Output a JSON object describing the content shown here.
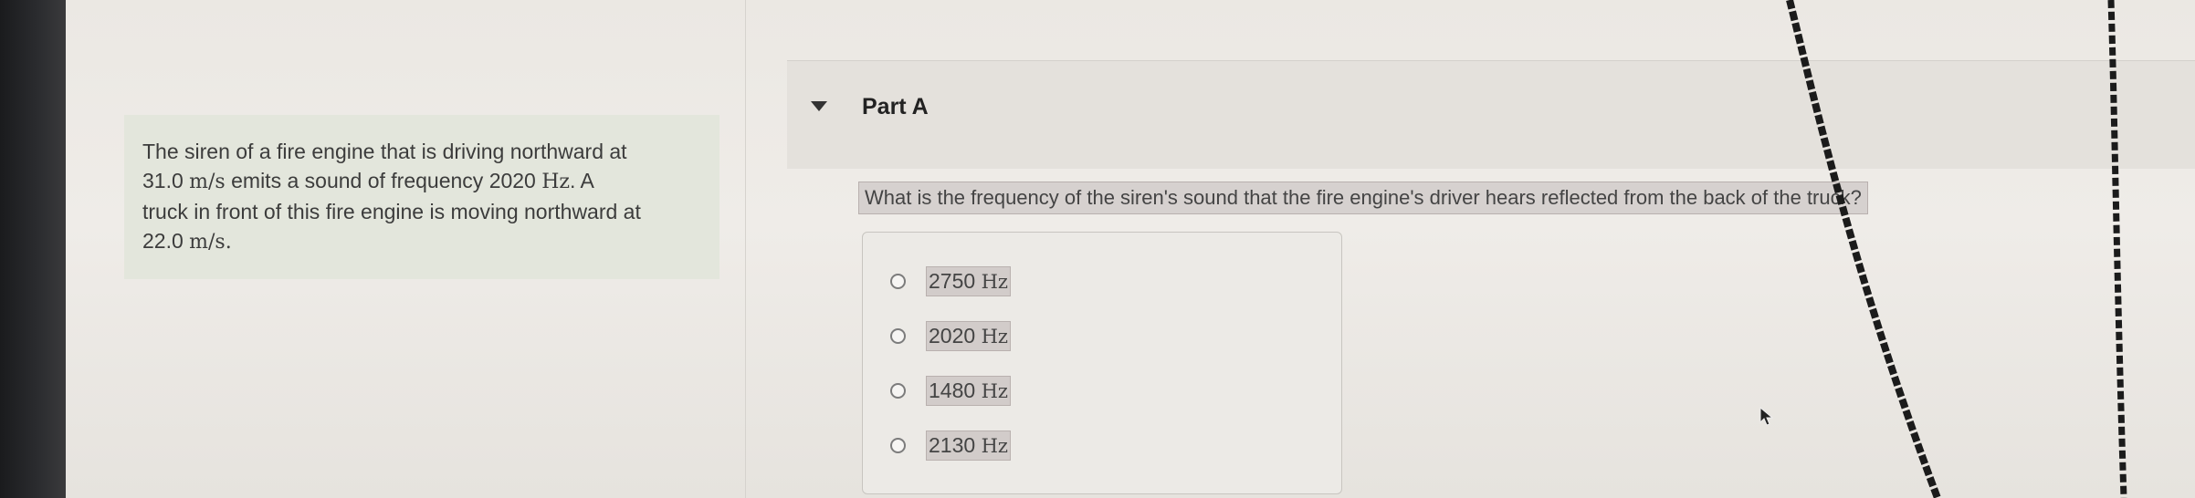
{
  "problem": {
    "line1": "The siren of a fire engine that is driving northward at",
    "line2_value": "31.0",
    "line2_unit": "m/s",
    "line2_mid": "emits a sound of frequency",
    "line2_freq": "2020",
    "line2_freq_unit": "Hz",
    "line2_end": ". A",
    "line3": "truck in front of this fire engine is moving northward at",
    "line4_value": "22.0",
    "line4_unit": "m/s",
    "line4_end": "."
  },
  "part": {
    "title": "Part A",
    "question": "What is the frequency of the siren's sound that the fire engine's driver hears reflected from the back of the truck?"
  },
  "options": [
    {
      "value": "2750",
      "unit": "Hz"
    },
    {
      "value": "2020",
      "unit": "Hz"
    },
    {
      "value": "1480",
      "unit": "Hz"
    },
    {
      "value": "2130",
      "unit": "Hz"
    }
  ],
  "icons": {
    "caret": "caret-down-icon",
    "radio": "radio-button-icon",
    "cursor": "mouse-cursor-icon"
  },
  "colors": {
    "problem_box": "#e3e6dc",
    "highlight": "#d6d1cf",
    "bezel": "#1a1b1d"
  }
}
